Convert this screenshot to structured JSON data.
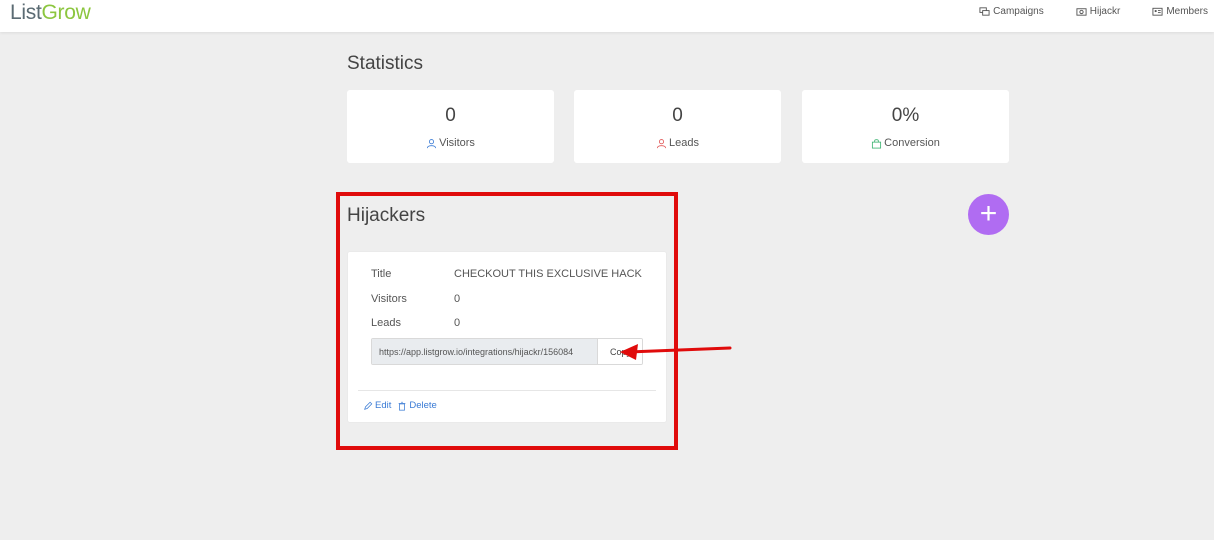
{
  "header": {
    "logo_part1": "List",
    "logo_part2": "Grow",
    "nav": [
      {
        "label": "Campaigns",
        "icon": "campaigns-icon"
      },
      {
        "label": "Hijackr",
        "icon": "hijackr-icon"
      },
      {
        "label": "Members",
        "icon": "members-icon"
      }
    ]
  },
  "statistics": {
    "title": "Statistics",
    "cards": [
      {
        "value": "0",
        "label": "Visitors",
        "icon": "users-icon",
        "icon_color": "#3a7bd5"
      },
      {
        "value": "0",
        "label": "Leads",
        "icon": "leads-icon",
        "icon_color": "#e05555"
      },
      {
        "value": "0%",
        "label": "Conversion",
        "icon": "bag-icon",
        "icon_color": "#3cb371"
      }
    ]
  },
  "hijackers": {
    "title": "Hijackers",
    "add_label": "+",
    "item": {
      "title_key": "Title",
      "title_value": "CHECKOUT THIS EXCLUSIVE HACK",
      "visitors_key": "Visitors",
      "visitors_value": "0",
      "leads_key": "Leads",
      "leads_value": "0",
      "url": "https://app.listgrow.io/integrations/hijackr/156084",
      "copy_label": "Copy",
      "edit_label": "Edit",
      "delete_label": "Delete"
    }
  },
  "colors": {
    "accent": "#b06cf2",
    "annotation": "#e00b0b",
    "link": "#3a7bd5"
  }
}
